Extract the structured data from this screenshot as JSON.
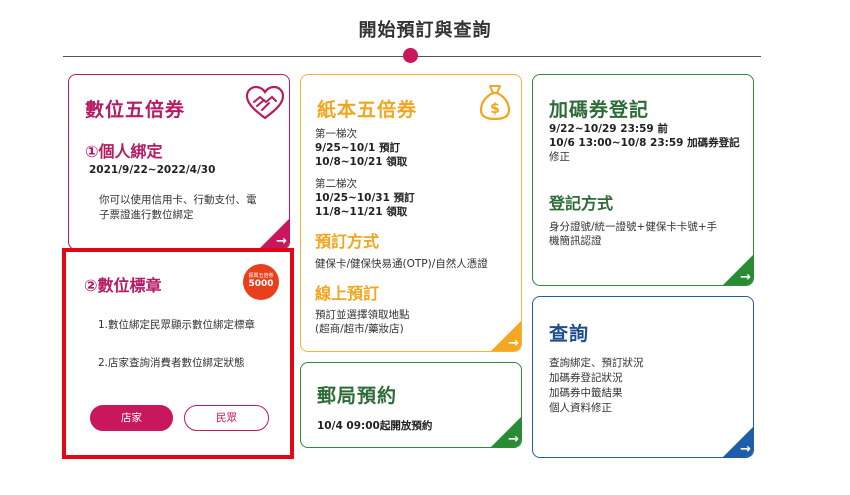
{
  "header": {
    "title": "開始預訂與查詢"
  },
  "digital_card": {
    "title": "數位五倍券",
    "icon": "heart-hands-icon",
    "personal_binding": {
      "label": "①個人綁定",
      "date": "2021/9/22~2022/4/30",
      "desc_1": "你可以使用信用卡、行動支付、電",
      "desc_2": "子票證進行數位綁定"
    },
    "badge": {
      "label": "②數位標章",
      "logo_text": "振興五倍券",
      "logo_sub": "5000",
      "item_1": "1.數位綁定民眾顯示數位綁定標章",
      "item_2": "2.店家查詢消費者數位綁定狀態",
      "store_button": "店家",
      "public_button": "民眾"
    }
  },
  "paper_card": {
    "title": "紙本五倍券",
    "icon": "money-bag-icon",
    "batch1_label": "第一梯次",
    "batch1_line1": "9/25~10/1 預訂",
    "batch1_line2": "10/8~10/21 領取",
    "batch2_label": "第二梯次",
    "batch2_line1": "10/25~10/31 預訂",
    "batch2_line2": "11/8~11/21 領取",
    "method_title": "預訂方式",
    "method_desc": "健保卡/健保快易通(OTP)/自然人憑證",
    "online_title": "線上預訂",
    "online_desc_1": "預訂並選擇領取地點",
    "online_desc_2": "(超商/超市/藥妝店)"
  },
  "post_card": {
    "title": "郵局預約",
    "desc": "10/4 09:00起開放預約"
  },
  "bonus_card": {
    "title": "加碼券登記",
    "line1": "9/22~10/29 23:59 前",
    "line2": "10/6 13:00~10/8 23:59 加碼券登記",
    "line3": "修正",
    "method_title": "登記方式",
    "method_desc_1": "身分證號/統一證號+健保卡卡號+手",
    "method_desc_2": "機簡訊認證"
  },
  "query_card": {
    "title": "查詢",
    "item_1": "查詢綁定、預訂狀況",
    "item_2": "加碼券登記狀況",
    "item_3": "加碼券中籤結果",
    "item_4": "個人資料修正"
  },
  "corner_arrow": "→",
  "colors": {
    "digital": "#c8175d",
    "paper": "#f5a623",
    "green": "#2a8b35",
    "blue": "#1e5ea8",
    "highlight": "#e30613"
  }
}
